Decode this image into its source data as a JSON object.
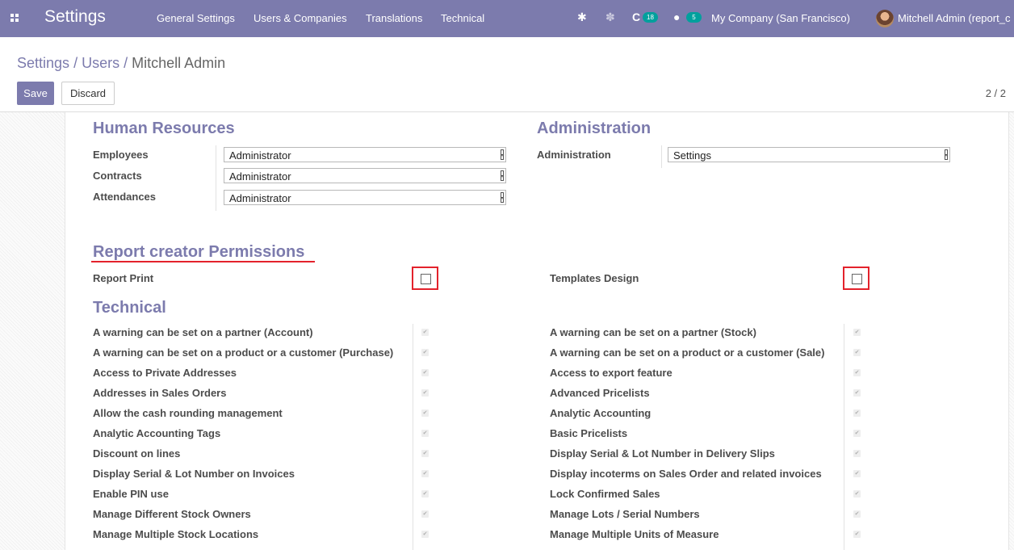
{
  "navbar": {
    "app_title": "Settings",
    "menu": [
      "General Settings",
      "Users & Companies",
      "Translations",
      "Technical"
    ],
    "activity_count": "18",
    "message_count": "5",
    "company": "My Company (San Francisco)",
    "user": "Mitchell Admin (report_c"
  },
  "control_panel": {
    "breadcrumb": [
      "Settings",
      "Users",
      "Mitchell Admin"
    ],
    "save_label": "Save",
    "discard_label": "Discard",
    "pager": "2 / 2"
  },
  "human_resources": {
    "title": "Human Resources",
    "fields": [
      {
        "label": "Employees",
        "value": "Administrator"
      },
      {
        "label": "Contracts",
        "value": "Administrator"
      },
      {
        "label": "Attendances",
        "value": "Administrator"
      }
    ]
  },
  "administration": {
    "title": "Administration",
    "fields": [
      {
        "label": "Administration",
        "value": "Settings"
      }
    ]
  },
  "report_creator": {
    "title": "Report creator Permissions",
    "left": {
      "label": "Report Print",
      "checked": false
    },
    "right": {
      "label": "Templates Design",
      "checked": false
    }
  },
  "technical": {
    "title": "Technical",
    "left": [
      "A warning can be set on a partner (Account)",
      "A warning can be set on a product or a customer (Purchase)",
      "Access to Private Addresses",
      "Addresses in Sales Orders",
      "Allow the cash rounding management",
      "Analytic Accounting Tags",
      "Discount on lines",
      "Display Serial & Lot Number on Invoices",
      "Enable PIN use",
      "Manage Different Stock Owners",
      "Manage Multiple Stock Locations"
    ],
    "right": [
      "A warning can be set on a partner (Stock)",
      "A warning can be set on a product or a customer (Sale)",
      "Access to export feature",
      "Advanced Pricelists",
      "Analytic Accounting",
      "Basic Pricelists",
      "Display Serial & Lot Number in Delivery Slips",
      "Display incoterms on Sales Order and related invoices",
      "Lock Confirmed Sales",
      "Manage Lots / Serial Numbers",
      "Manage Multiple Units of Measure"
    ]
  },
  "colors": {
    "brand": "#7c7bad",
    "highlight": "#e3222c"
  }
}
